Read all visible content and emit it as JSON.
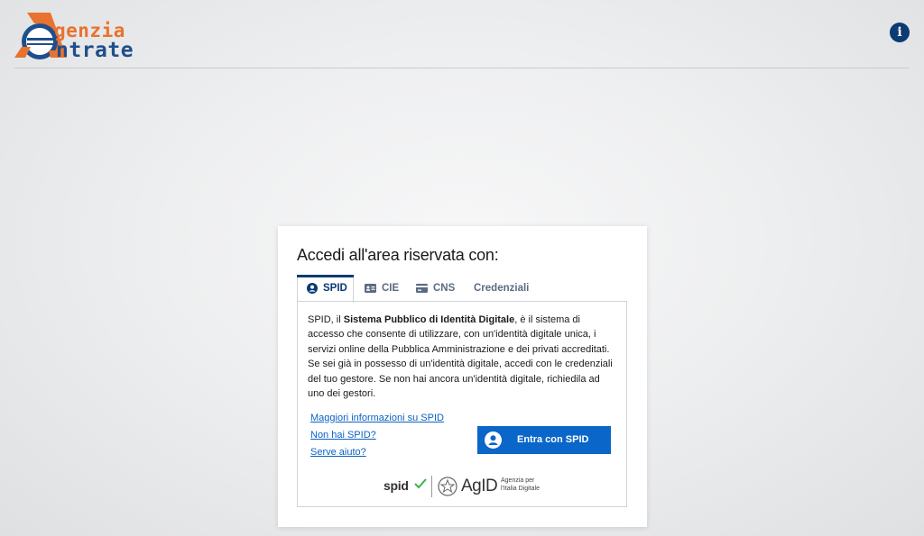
{
  "header": {
    "logo_line1": "genzia",
    "logo_line2": "ntrate",
    "info_icon": "info-circle-icon",
    "info_glyph": "i"
  },
  "login": {
    "title": "Accedi all'area riservata con:",
    "tabs": [
      {
        "label": "SPID",
        "icon": "user-circle-icon",
        "active": true
      },
      {
        "label": "CIE",
        "icon": "id-card-icon",
        "active": false
      },
      {
        "label": "CNS",
        "icon": "credit-card-icon",
        "active": false
      },
      {
        "label": "Credenziali",
        "icon": "",
        "active": false
      }
    ],
    "description": {
      "prefix": "SPID, il ",
      "bold": "Sistema Pubblico di Identità Digitale",
      "suffix": ", è il sistema di accesso che consente di utilizzare, con un'identità digitale unica, i servizi online della Pubblica Amministrazione e dei privati accreditati. Se sei già in possesso di un'identità digitale, accedi con le credenziali del tuo gestore. Se non hai ancora un'identità digitale, richiedila ad uno dei gestori."
    },
    "links": [
      "Maggiori informazioni su SPID",
      "Non hai SPID?",
      "Serve aiuto?"
    ],
    "spid_button_label": "Entra con SPID",
    "footer": {
      "spid_logo": "spid",
      "agid_logo": "AgID",
      "agid_sub_line1": "Agenzia per",
      "agid_sub_line2": "l'Italia Digitale"
    }
  },
  "colors": {
    "brand_navy": "#0b3a74",
    "button_blue": "#0a66c8",
    "logo_orange": "#e8732e",
    "logo_blue": "#1f4e8c"
  }
}
